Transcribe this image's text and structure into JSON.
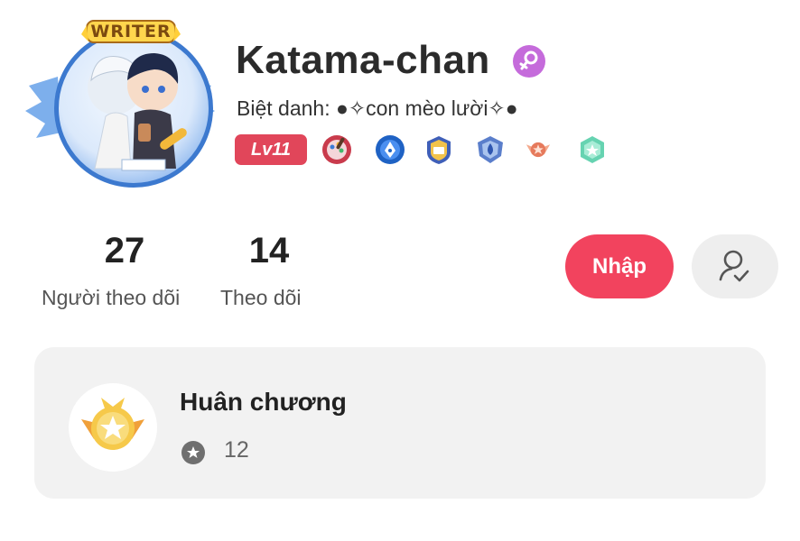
{
  "profile": {
    "avatar_badge": "WRITER",
    "username": "Katama-chan",
    "gender_icon": "female-symbol-icon",
    "nickname": "Biệt danh: ●✧con mèo lười✧●",
    "level": "Lv11",
    "medal_icons": [
      "palette-medal-icon",
      "pen-nib-medal-icon",
      "book-shield-medal-icon",
      "droplet-shield-medal-icon",
      "winged-bronze-medal-icon",
      "green-star-medal-icon"
    ]
  },
  "stats": {
    "followers_count": "27",
    "followers_label": "Người theo dõi",
    "following_count": "14",
    "following_label": "Theo dõi"
  },
  "actions": {
    "enter_label": "Nhập",
    "follow_icon": "user-check-icon"
  },
  "medals_section": {
    "title": "Huân chương",
    "count": "12",
    "icon": "gold-star-medal-icon"
  },
  "colors": {
    "accent": "#f2435e",
    "level_badge": "#e1465a",
    "gender": "#c56bdb",
    "card_bg": "#f2f2f2"
  }
}
